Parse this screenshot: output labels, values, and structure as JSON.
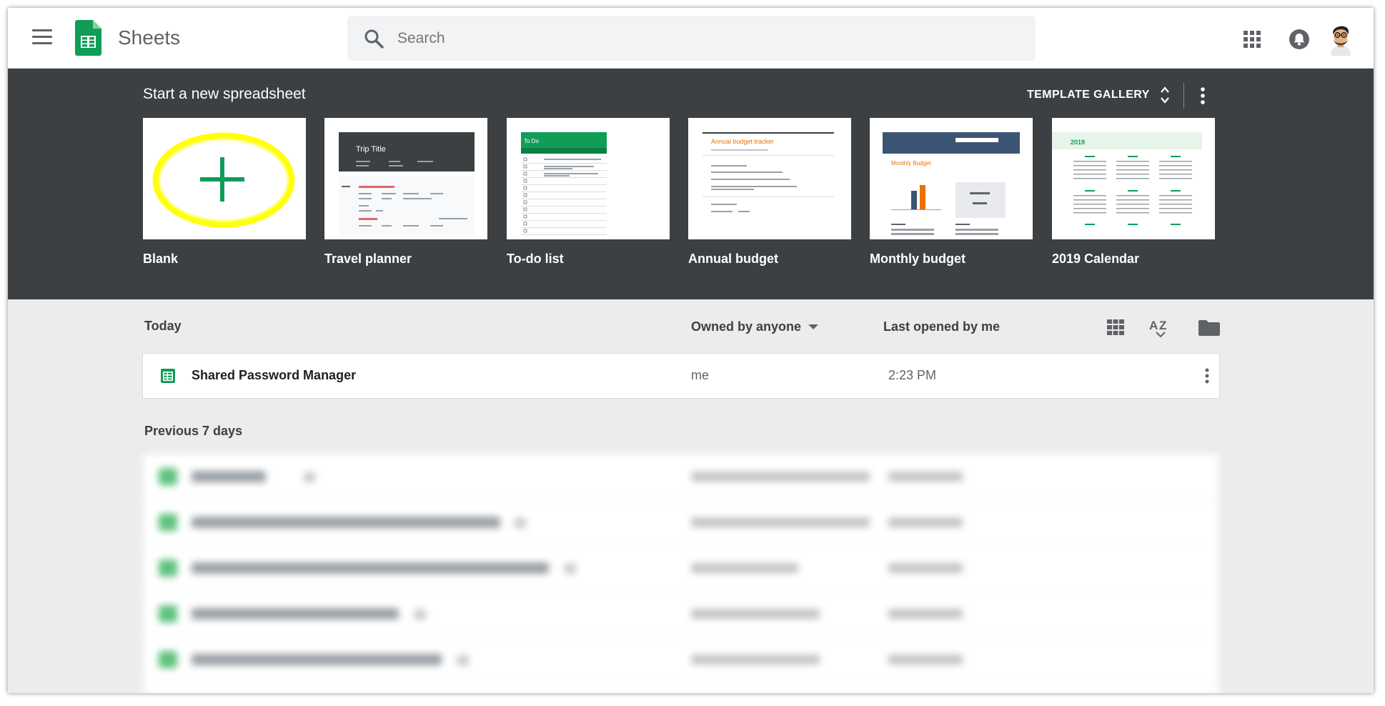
{
  "app": {
    "title": "Sheets"
  },
  "search": {
    "placeholder": "Search"
  },
  "templates": {
    "heading": "Start a new spreadsheet",
    "gallery_label": "TEMPLATE GALLERY",
    "items": [
      {
        "label": "Blank"
      },
      {
        "label": "Travel planner",
        "thumb_title": "Trip Title"
      },
      {
        "label": "To-do list",
        "thumb_title": "To Do"
      },
      {
        "label": "Annual budget",
        "thumb_title": "Annual budget tracker"
      },
      {
        "label": "Monthly budget",
        "thumb_title": "Monthly Budget"
      },
      {
        "label": "2019 Calendar",
        "thumb_title": "2019"
      }
    ]
  },
  "list": {
    "today_heading": "Today",
    "owner_filter": "Owned by anyone",
    "sort_label": "Last opened by me",
    "previous_heading": "Previous 7 days",
    "files_today": [
      {
        "name": "Shared Password Manager",
        "owner": "me",
        "opened": "2:23 PM"
      }
    ]
  },
  "colors": {
    "accent": "#0f9d58",
    "band": "#3c4043",
    "highlight": "#ffff00"
  }
}
